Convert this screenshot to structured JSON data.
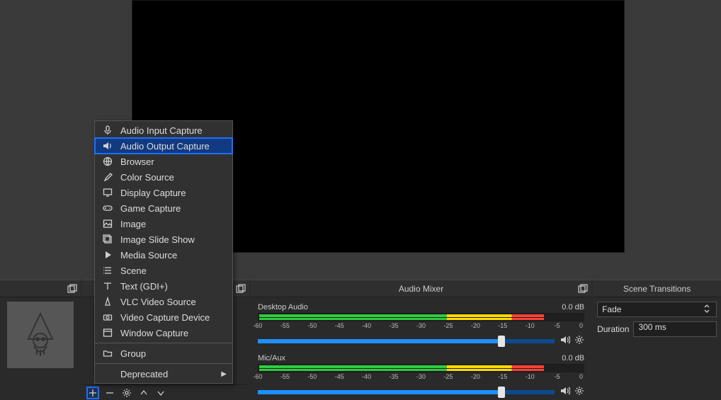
{
  "docks": {
    "scenes_title": "",
    "sources_title": "",
    "mixer_title": "Audio Mixer",
    "transitions_title": "Scene Transitions"
  },
  "mixer": {
    "ch1": {
      "name": "Desktop Audio",
      "level": "0.0 dB"
    },
    "ch2": {
      "name": "Mic/Aux",
      "level": "0.0 dB"
    },
    "scale": [
      "-60",
      "-55",
      "-50",
      "-45",
      "-40",
      "-35",
      "-30",
      "-25",
      "-20",
      "-15",
      "-10",
      "-5",
      "0"
    ]
  },
  "transitions": {
    "selected": "Fade",
    "duration_label": "Duration",
    "duration_value": "300 ms"
  },
  "context_menu": {
    "items": [
      {
        "id": "audio-input",
        "label": "Audio Input Capture"
      },
      {
        "id": "audio-output",
        "label": "Audio Output Capture",
        "highlighted": true
      },
      {
        "id": "browser",
        "label": "Browser"
      },
      {
        "id": "color-source",
        "label": "Color Source"
      },
      {
        "id": "display-capture",
        "label": "Display Capture"
      },
      {
        "id": "game-capture",
        "label": "Game Capture"
      },
      {
        "id": "image",
        "label": "Image"
      },
      {
        "id": "image-slideshow",
        "label": "Image Slide Show"
      },
      {
        "id": "media-source",
        "label": "Media Source"
      },
      {
        "id": "scene",
        "label": "Scene"
      },
      {
        "id": "text-gdi",
        "label": "Text (GDI+)"
      },
      {
        "id": "vlc-source",
        "label": "VLC Video Source"
      },
      {
        "id": "video-capture",
        "label": "Video Capture Device"
      },
      {
        "id": "window-capture",
        "label": "Window Capture"
      }
    ],
    "group_label": "Group",
    "deprecated_label": "Deprecated"
  }
}
